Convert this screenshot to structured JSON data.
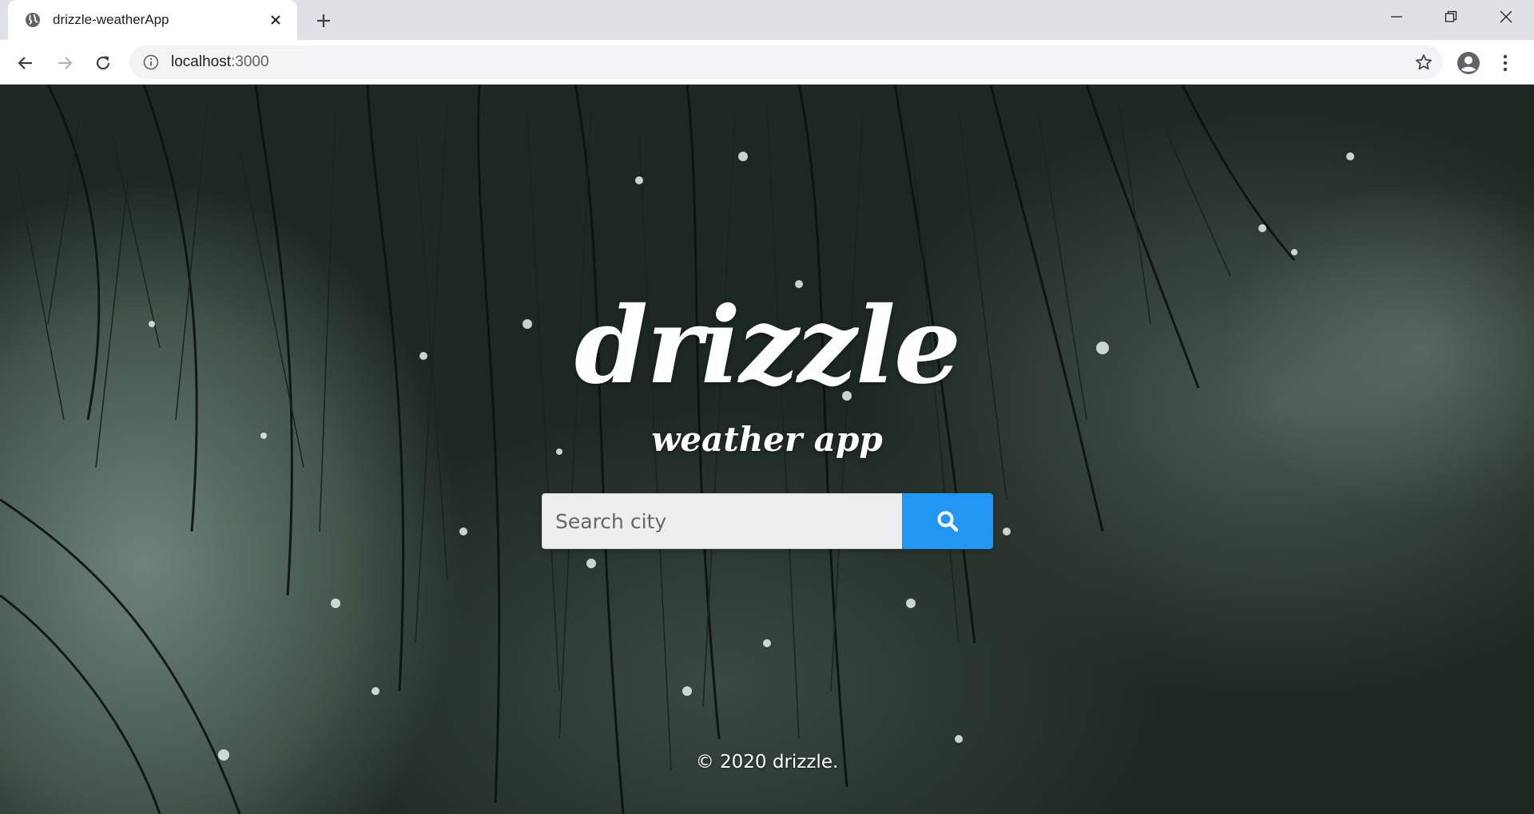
{
  "browser": {
    "tab_title": "drizzle-weatherApp",
    "url_host": "localhost",
    "url_port": ":3000",
    "icons": {
      "favicon": "globe-icon",
      "tab_close": "close-icon",
      "new_tab": "plus-icon",
      "back": "arrow-left-icon",
      "forward": "arrow-right-icon",
      "reload": "reload-icon",
      "site_info": "info-icon",
      "bookmark": "star-icon",
      "profile": "account-circle-icon",
      "menu": "kebab-menu-icon",
      "minimize": "minimize-icon",
      "restore": "restore-icon",
      "close_window": "close-icon"
    }
  },
  "app": {
    "logo": "drizzle",
    "tagline": "weather app",
    "search": {
      "placeholder": "Search city",
      "value": "",
      "button_icon": "search-icon",
      "button_color": "#2196f3"
    },
    "footer": "© 2020 drizzle."
  }
}
